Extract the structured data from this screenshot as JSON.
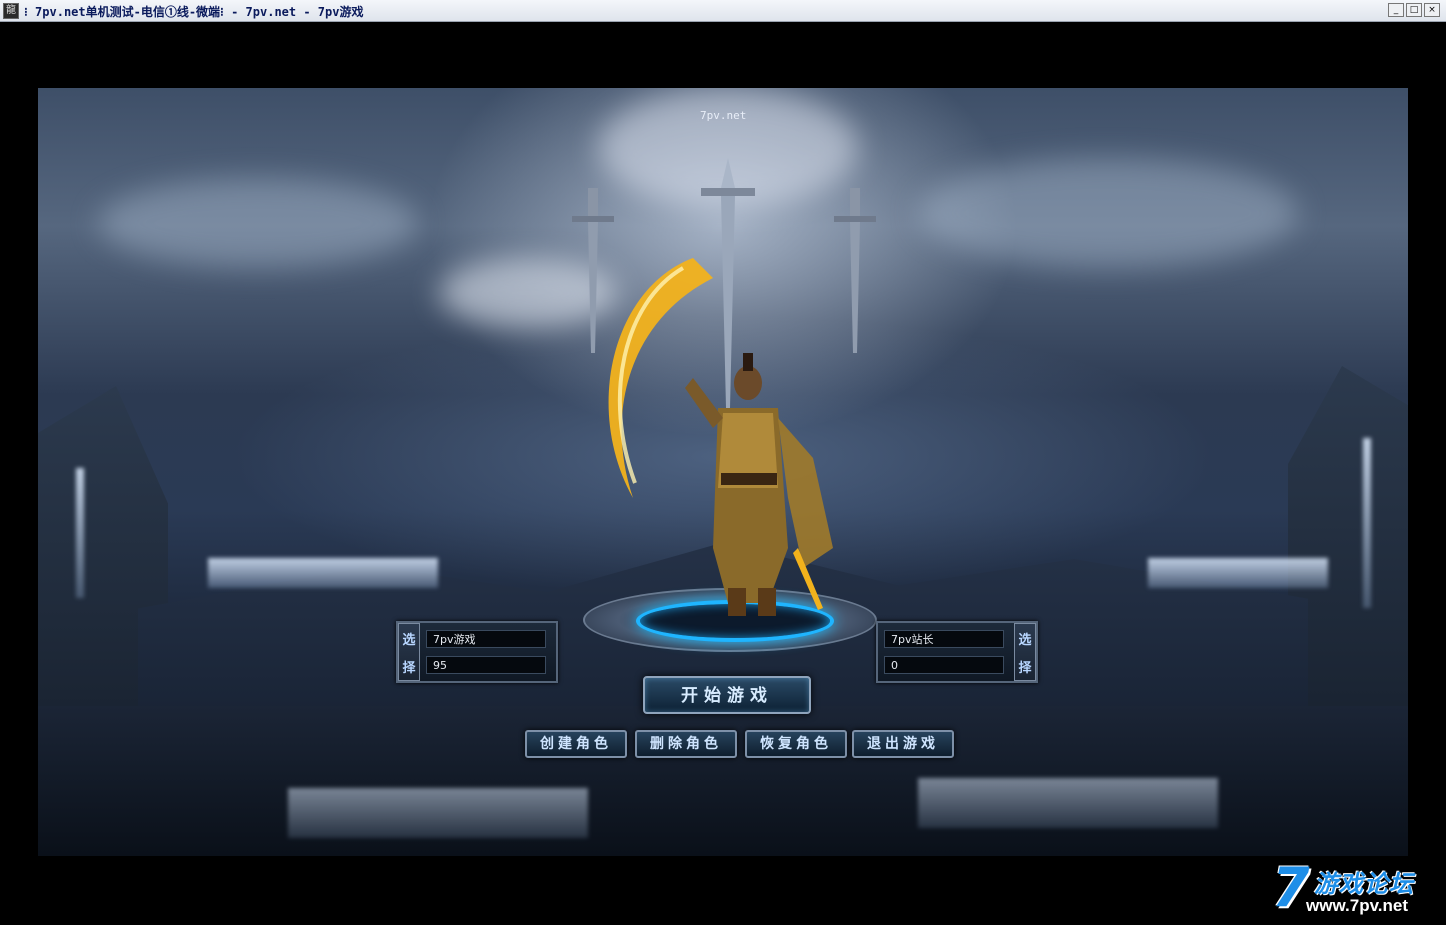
{
  "window": {
    "title": "⁝ 7pv.net单机测试-电信①线-微端⁝ - 7pv.net - 7pv游戏",
    "icon_name": "app-icon",
    "controls": [
      "_",
      "□",
      "×"
    ]
  },
  "scene": {
    "top_label": "7pv.net",
    "left_slot": {
      "select_chars": [
        "选",
        "择"
      ],
      "name": "7pv游戏",
      "level": "95"
    },
    "right_slot": {
      "select_chars": [
        "选",
        "择"
      ],
      "name": "7pv站长",
      "level": "0"
    },
    "start_button": "开始游戏",
    "actions": [
      "创建角色",
      "删除角色",
      "恢复角色",
      "退出游戏"
    ]
  },
  "forum_logo": {
    "seven": "7",
    "text": "游戏论坛",
    "url": "www.7pv.net"
  },
  "colors": {
    "title_text": "#0a1a5c",
    "ring_glow": "#1fb5ff",
    "logo_blue": "#1e8ee8",
    "weapon_gold": "#f2b21c"
  }
}
